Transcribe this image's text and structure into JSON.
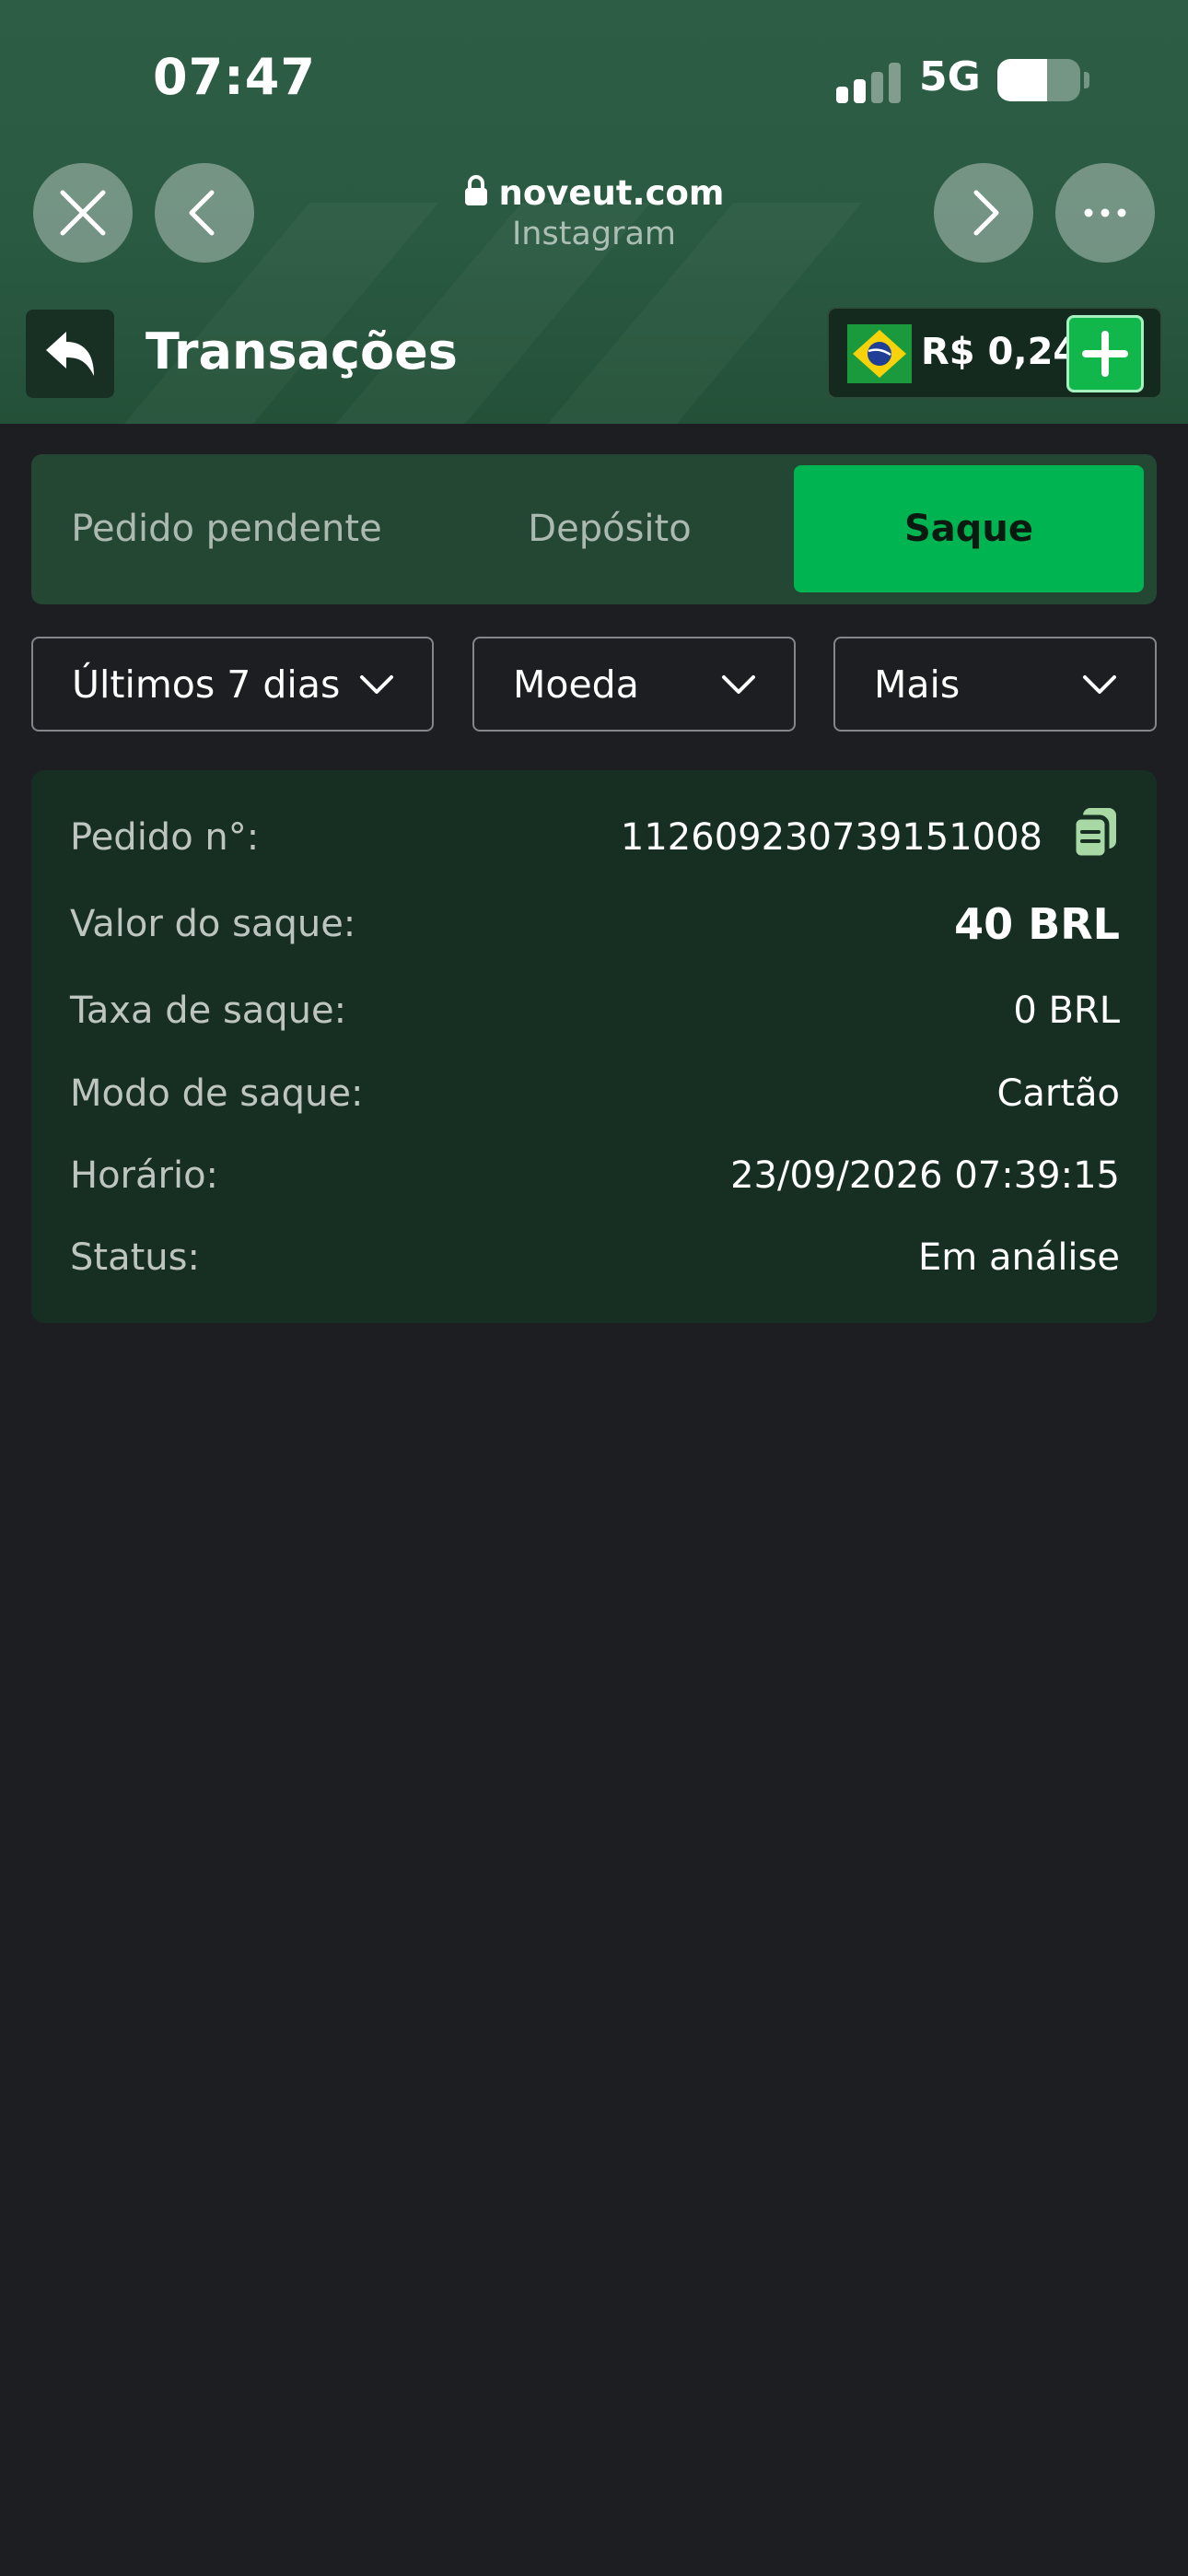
{
  "status_bar": {
    "time": "07:47",
    "network": "5G",
    "signal_bars_active": 2,
    "battery_level": 0.6
  },
  "browser": {
    "domain": "noveut.com",
    "source": "Instagram",
    "icons": [
      "close-icon",
      "back-arrow-icon",
      "lock-icon",
      "forward-arrow-icon",
      "more-icon"
    ]
  },
  "app_bar": {
    "title": "Transações",
    "balance": "R$ 0,24",
    "icons": [
      "return-arrow-icon",
      "brazil-flag-icon",
      "plus-icon"
    ]
  },
  "tabs": [
    {
      "label": "Pedido pendente",
      "active": false
    },
    {
      "label": "Depósito",
      "active": false
    },
    {
      "label": "Saque",
      "active": true
    }
  ],
  "filters": {
    "period": "Últimos 7 dias",
    "currency": "Moeda",
    "more": "Mais"
  },
  "transaction": {
    "rows": [
      {
        "label": "Pedido n°:",
        "value": "112609230739151008"
      },
      {
        "label": "Valor do saque:",
        "value": "40 BRL"
      },
      {
        "label": "Taxa de saque:",
        "value": "0 BRL"
      },
      {
        "label": "Modo de saque:",
        "value": "Cartão"
      },
      {
        "label": "Horário:",
        "value": "23/09/2026 07:39:15"
      },
      {
        "label": "Status:",
        "value": "Em análise"
      }
    ]
  },
  "colors": {
    "header": "#2d5e45",
    "accent_green": "#00b451",
    "page_background": "#1d1e22",
    "card_background": "#162f22",
    "tab_bar": "#244734"
  }
}
